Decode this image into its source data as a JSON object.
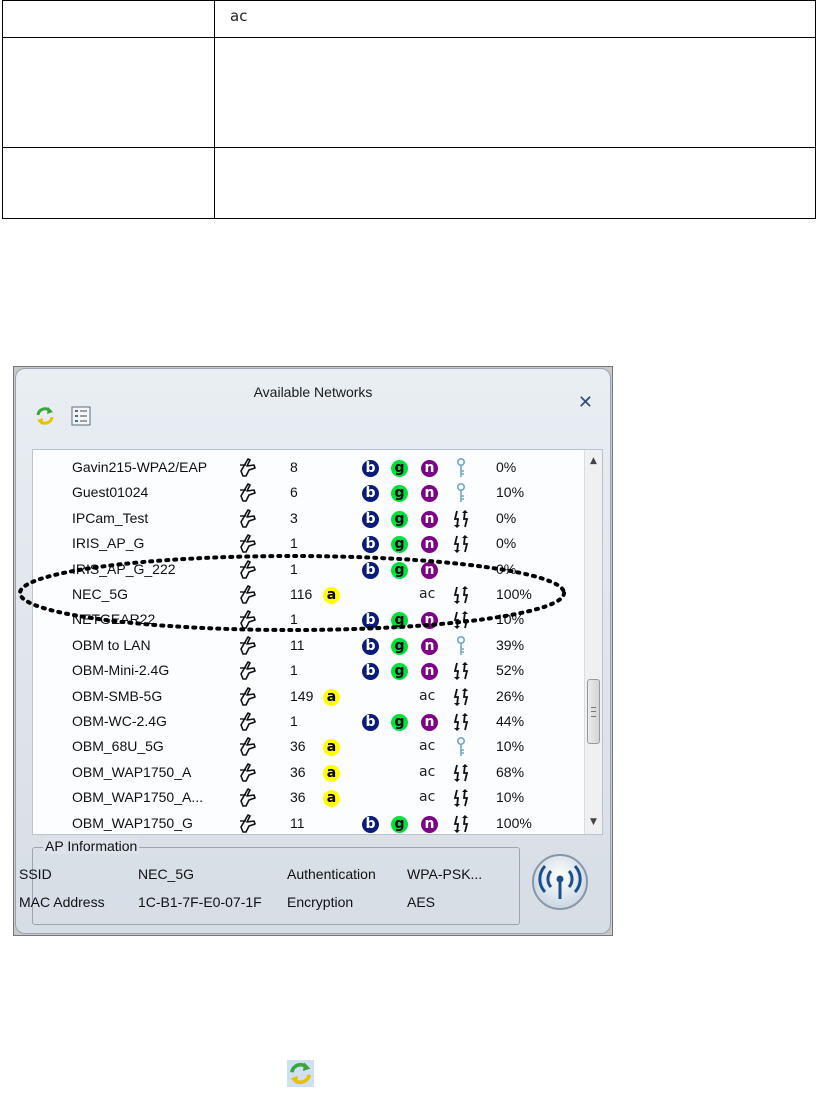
{
  "doc_table": {
    "rows": [
      {
        "label": "",
        "value": "ac"
      },
      {
        "label": "",
        "value": ""
      },
      {
        "label": "",
        "value": ""
      }
    ]
  },
  "dialog": {
    "title": "Available Networks",
    "close_label": "✕",
    "networks": [
      {
        "ssid": "Gavin215-WPA2/EAP",
        "channel": "8",
        "modes": [
          "b",
          "g",
          "n"
        ],
        "security": "key",
        "signal": "0%"
      },
      {
        "ssid": "Guest01024",
        "channel": "6",
        "modes": [
          "b",
          "g",
          "n"
        ],
        "security": "key",
        "signal": "10%"
      },
      {
        "ssid": "IPCam_Test",
        "channel": "3",
        "modes": [
          "b",
          "g",
          "n"
        ],
        "security": "open",
        "signal": "0%"
      },
      {
        "ssid": "IRIS_AP_G",
        "channel": "1",
        "modes": [
          "b",
          "g",
          "n"
        ],
        "security": "open",
        "signal": "0%"
      },
      {
        "ssid": "IRIS_AP_G_222",
        "channel": "1",
        "modes": [
          "b",
          "g",
          "n"
        ],
        "security": "none",
        "signal": "0%"
      },
      {
        "ssid": "NEC_5G",
        "channel": "116",
        "modes": [
          "a",
          "ac"
        ],
        "security": "open",
        "signal": "100%"
      },
      {
        "ssid": "NETGEAR22",
        "channel": "1",
        "modes": [
          "b",
          "g",
          "n"
        ],
        "security": "open",
        "signal": "10%"
      },
      {
        "ssid": "OBM to LAN",
        "channel": "11",
        "modes": [
          "b",
          "g",
          "n"
        ],
        "security": "key",
        "signal": "39%"
      },
      {
        "ssid": "OBM-Mini-2.4G",
        "channel": "1",
        "modes": [
          "b",
          "g",
          "n"
        ],
        "security": "open",
        "signal": "52%"
      },
      {
        "ssid": "OBM-SMB-5G",
        "channel": "149",
        "modes": [
          "a",
          "ac"
        ],
        "security": "open",
        "signal": "26%"
      },
      {
        "ssid": "OBM-WC-2.4G",
        "channel": "1",
        "modes": [
          "b",
          "g",
          "n"
        ],
        "security": "open",
        "signal": "44%"
      },
      {
        "ssid": "OBM_68U_5G",
        "channel": "36",
        "modes": [
          "a",
          "ac"
        ],
        "security": "key",
        "signal": "10%"
      },
      {
        "ssid": "OBM_WAP1750_A",
        "channel": "36",
        "modes": [
          "a",
          "ac"
        ],
        "security": "open",
        "signal": "68%"
      },
      {
        "ssid": "OBM_WAP1750_A...",
        "channel": "36",
        "modes": [
          "a",
          "ac"
        ],
        "security": "open",
        "signal": "10%"
      },
      {
        "ssid": "OBM_WAP1750_G",
        "channel": "11",
        "modes": [
          "b",
          "g",
          "n"
        ],
        "security": "open",
        "signal": "100%"
      }
    ],
    "mode_letters": {
      "a": "a",
      "b": "b",
      "g": "g",
      "n": "n",
      "ac": "ac"
    },
    "ap_info": {
      "legend": "AP Information",
      "ssid_label": "SSID",
      "ssid_value": "NEC_5G",
      "auth_label": "Authentication",
      "auth_value": "WPA-PSK...",
      "mac_label": "MAC Address",
      "mac_value": "1C-B1-7F-E0-07-1F",
      "enc_label": "Encryption",
      "enc_value": "AES"
    }
  },
  "colors": {
    "mode_a": "#ffff00",
    "mode_b": "#0a1b7a",
    "mode_g": "#00e03b",
    "mode_n": "#7d0087",
    "key_icon": "#6fa8c8",
    "close": "#2d4d75",
    "refresh_green": "#3aa63a",
    "refresh_yellow": "#e6c200"
  }
}
